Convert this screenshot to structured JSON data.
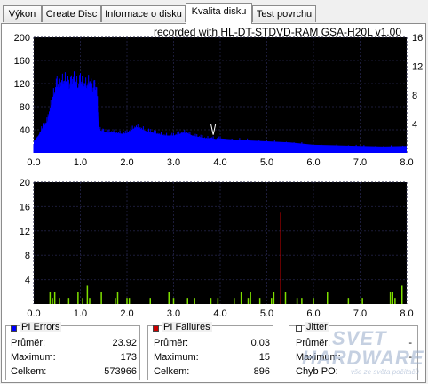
{
  "tabs": [
    {
      "label": "Výkon",
      "active": false
    },
    {
      "label": "Create Disc",
      "active": false
    },
    {
      "label": "Informace o disku",
      "active": false
    },
    {
      "label": "Kvalita disku",
      "active": true
    },
    {
      "label": "Test povrchu",
      "active": false
    }
  ],
  "recorded_with": "recorded with HL-DT-STDVD-RAM GSA-H20L v1.00",
  "colors": {
    "pie": "#0000ff",
    "pif_bar": "#7fe000",
    "pif_spike": "#cc0000",
    "speed_line": "#ffffff"
  },
  "chart_data": [
    {
      "type": "bar",
      "title": "",
      "x_ticks": [
        "0.0",
        "1.0",
        "2.0",
        "3.0",
        "4.0",
        "5.0",
        "6.0",
        "7.0",
        "8.0"
      ],
      "y_ticks_left": [
        "200",
        "160",
        "120",
        "80",
        "40"
      ],
      "y_ticks_right": [
        "16",
        "12",
        "8",
        "4"
      ],
      "xlim": [
        0,
        8
      ],
      "ylim": [
        0,
        200
      ],
      "y2lim": [
        0,
        16
      ],
      "grid": true,
      "series": [
        {
          "kind": "area",
          "x": [
            0.0,
            0.1,
            0.2,
            0.3,
            0.35,
            0.4,
            0.45,
            0.5,
            0.55,
            0.6,
            0.65,
            0.7,
            0.75,
            0.8,
            0.85,
            0.9,
            0.95,
            1.0,
            1.05,
            1.1,
            1.15,
            1.2,
            1.25,
            1.3,
            1.35,
            1.4,
            1.45,
            1.5,
            1.6,
            1.7,
            1.8,
            1.9,
            2.0,
            2.1,
            2.2,
            2.3,
            2.4,
            2.5,
            2.6,
            2.7,
            2.8,
            2.9,
            3.0,
            3.1,
            3.2,
            3.3,
            3.4,
            3.5,
            3.6,
            3.7,
            3.8,
            3.9,
            4.0,
            4.5,
            5.0,
            5.5,
            6.0,
            6.5,
            7.0,
            7.5,
            8.0
          ],
          "y": [
            20,
            30,
            45,
            55,
            75,
            90,
            105,
            115,
            110,
            120,
            118,
            125,
            110,
            115,
            125,
            118,
            112,
            120,
            115,
            115,
            110,
            125,
            105,
            110,
            108,
            40,
            38,
            36,
            35,
            36,
            34,
            33,
            34,
            40,
            45,
            42,
            38,
            36,
            34,
            32,
            30,
            30,
            30,
            32,
            35,
            34,
            30,
            28,
            27,
            25,
            26,
            24,
            25,
            22,
            20,
            18,
            14,
            13,
            12,
            11,
            12
          ]
        },
        {
          "kind": "line",
          "x": [
            0.0,
            1.0,
            2.0,
            3.0,
            3.8,
            3.85,
            3.9,
            4.0,
            5.0,
            6.0,
            7.0,
            8.0
          ],
          "y": [
            4.0,
            4.0,
            4.0,
            4.0,
            4.0,
            2.5,
            4.0,
            4.0,
            4.0,
            4.0,
            4.0,
            4.0
          ]
        }
      ]
    },
    {
      "type": "bar",
      "title": "",
      "x_ticks": [
        "0.0",
        "1.0",
        "2.0",
        "3.0",
        "4.0",
        "5.0",
        "6.0",
        "7.0",
        "8.0"
      ],
      "y_ticks_left": [
        "20",
        "16",
        "12",
        "8",
        "4"
      ],
      "xlim": [
        0,
        8
      ],
      "ylim": [
        0,
        20
      ],
      "grid": true,
      "series": [
        {
          "kind": "bars",
          "x": [
            0.35,
            0.4,
            0.45,
            0.55,
            0.75,
            0.95,
            1.05,
            1.15,
            1.2,
            1.45,
            1.75,
            1.8,
            2.0,
            2.05,
            2.5,
            2.9,
            3.0,
            3.3,
            3.45,
            3.8,
            3.95,
            4.3,
            4.45,
            4.6,
            4.65,
            4.85,
            5.1,
            5.15,
            5.3,
            5.4,
            5.65,
            5.75,
            6.0,
            6.3,
            6.75,
            7.05,
            7.65,
            7.7,
            7.75,
            7.9
          ],
          "y": [
            2,
            1,
            2,
            1,
            1,
            2,
            1,
            3,
            1,
            2,
            1,
            2,
            1,
            1,
            1,
            2,
            1,
            1,
            1,
            1,
            1,
            1,
            2,
            1,
            2,
            1,
            1,
            2,
            1,
            2,
            1,
            1,
            1,
            2,
            1,
            1,
            2,
            2,
            1,
            3
          ]
        },
        {
          "kind": "spike",
          "x": [
            5.3
          ],
          "y": [
            15
          ]
        }
      ]
    }
  ],
  "stats": {
    "pi_errors": {
      "title": "PI Errors",
      "rows": [
        {
          "label": "Průměr:",
          "value": "23.92"
        },
        {
          "label": "Maximum:",
          "value": "173"
        },
        {
          "label": "Celkem:",
          "value": "573966"
        }
      ]
    },
    "pi_failures": {
      "title": "PI Failures",
      "rows": [
        {
          "label": "Průměr:",
          "value": "0.03"
        },
        {
          "label": "Maximum:",
          "value": "15"
        },
        {
          "label": "Celkem:",
          "value": "896"
        }
      ]
    },
    "jitter": {
      "title": "Jitter",
      "rows": [
        {
          "label": "Průměr:",
          "value": "-"
        },
        {
          "label": "Maximum:",
          "value": "-"
        },
        {
          "label": "Chyb PO:",
          "value": ""
        }
      ]
    }
  },
  "watermark": {
    "line1": "SVET",
    "line2": "HARDWARE",
    "line3": "vše ze světa počítačů"
  }
}
